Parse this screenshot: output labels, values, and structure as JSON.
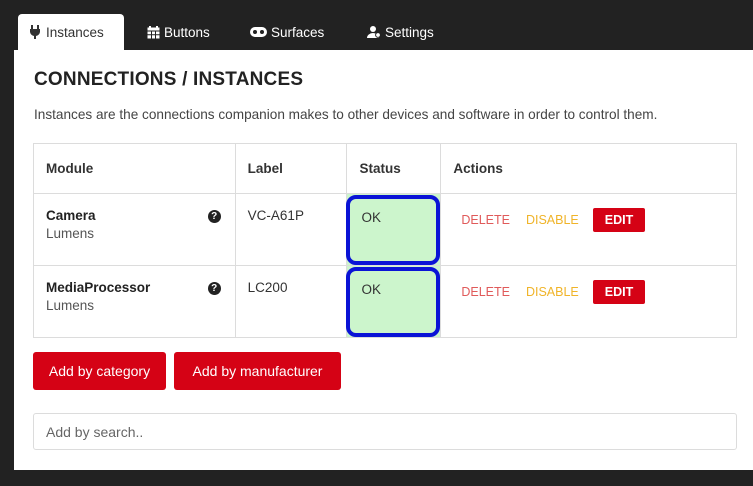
{
  "tabs": [
    {
      "label": "Instances",
      "icon": "plug-icon",
      "active": true
    },
    {
      "label": "Buttons",
      "icon": "calendar-grid-icon",
      "active": false
    },
    {
      "label": "Surfaces",
      "icon": "gamepad-icon",
      "active": false
    },
    {
      "label": "Settings",
      "icon": "user-gear-icon",
      "active": false
    }
  ],
  "page": {
    "title": "CONNECTIONS / INSTANCES",
    "description": "Instances are the connections companion makes to other devices and software in order to control them."
  },
  "table": {
    "headers": [
      "Module",
      "Label",
      "Status",
      "Actions"
    ],
    "rows": [
      {
        "module": "Camera",
        "maker": "Lumens",
        "label": "VC-A61P",
        "status": "OK"
      },
      {
        "module": "MediaProcessor",
        "maker": "Lumens",
        "label": "LC200",
        "status": "OK"
      }
    ],
    "actions": {
      "delete": "DELETE",
      "disable": "DISABLE",
      "edit": "EDIT"
    }
  },
  "buttons": {
    "add_by_category": "Add by category",
    "add_by_manufacturer": "Add by manufacturer"
  },
  "search": {
    "placeholder": "Add by search..",
    "value": ""
  },
  "colors": {
    "accent": "#d50215",
    "status_ok_bg": "#ccf5cc",
    "highlight_ring": "#0a13d6",
    "tabbar_bg": "#222222"
  }
}
